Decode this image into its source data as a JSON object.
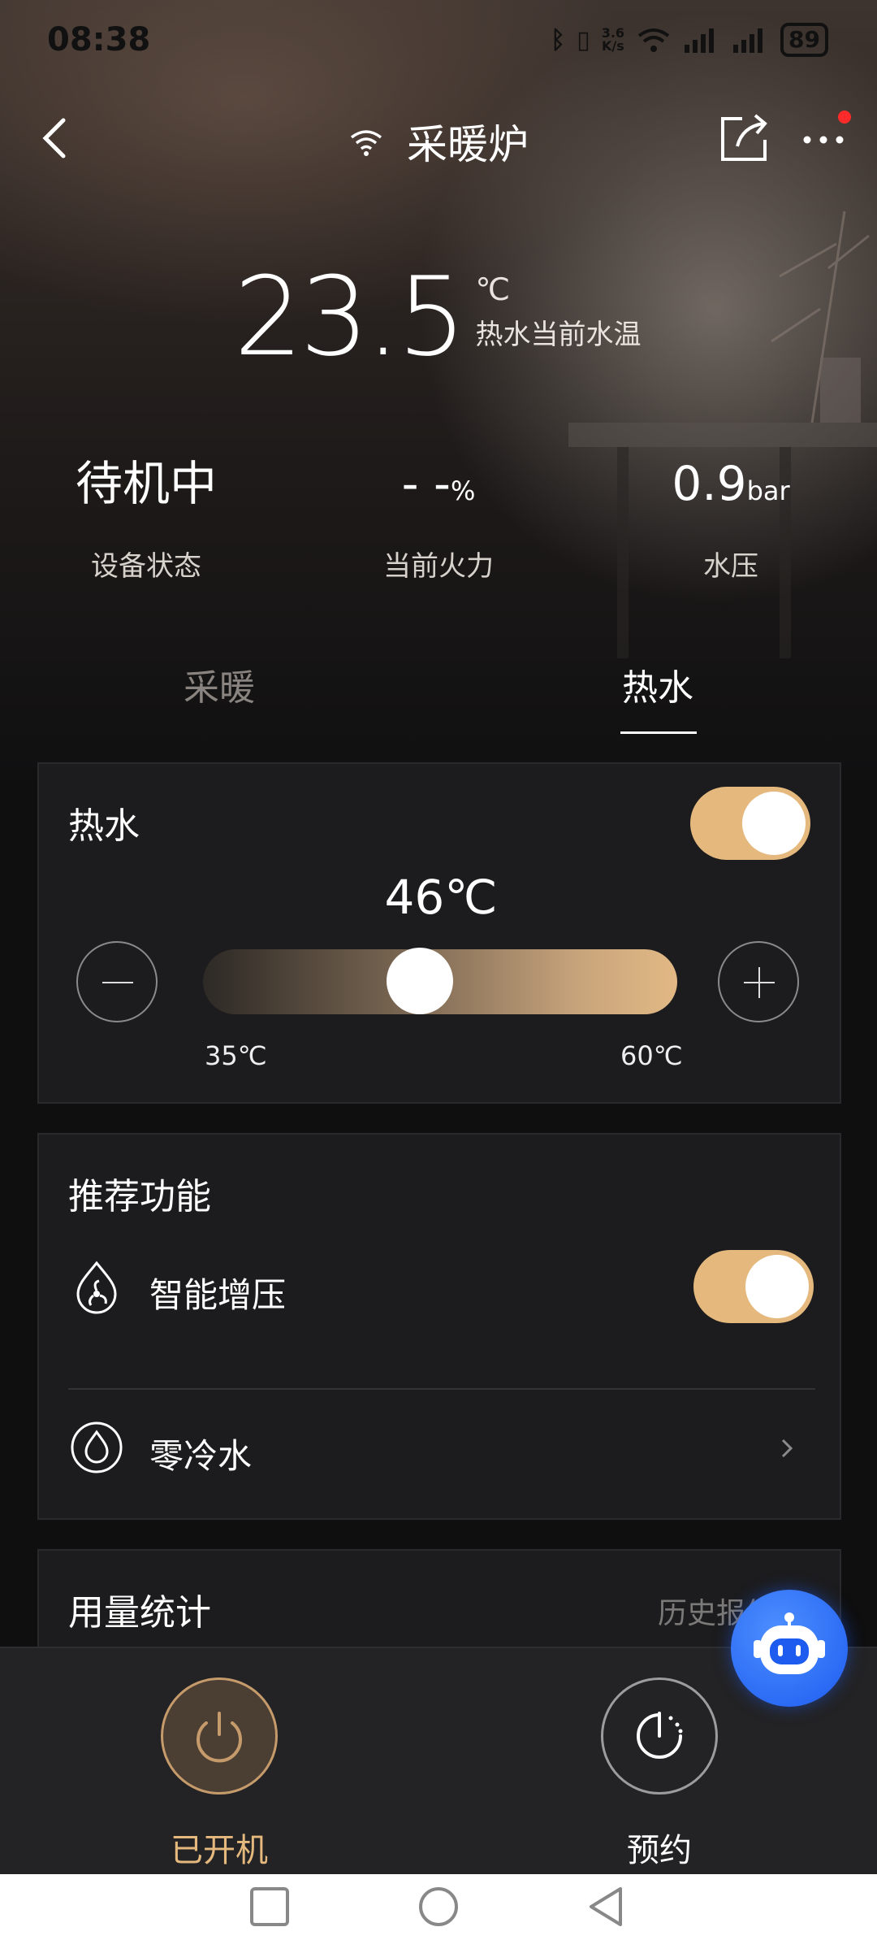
{
  "status_bar": {
    "time": "08:38",
    "network_speed": "3.6\nK/s",
    "battery": "89"
  },
  "nav": {
    "title": "采暖炉"
  },
  "hero": {
    "temperature": "23.5",
    "unit": "℃",
    "desc": "热水当前水温"
  },
  "stats": [
    {
      "value": "待机中",
      "unit": "",
      "label": "设备状态"
    },
    {
      "value": "- -",
      "unit": "%",
      "label": "当前火力"
    },
    {
      "value": "0.9",
      "unit": "bar",
      "label": "水压"
    }
  ],
  "tabs": [
    {
      "label": "采暖"
    },
    {
      "label": "热水"
    }
  ],
  "hot_water": {
    "title": "热水",
    "toggle_on": true,
    "set_temp": "46℃",
    "min": "35℃",
    "max": "60℃",
    "level_fraction": 0.44
  },
  "recommended": {
    "title": "推荐功能",
    "items": [
      {
        "label": "智能增压",
        "toggle_on": true
      },
      {
        "label": "零冷水"
      }
    ]
  },
  "usage": {
    "title": "用量统计",
    "link": "历史报告"
  },
  "bottom_actions": [
    {
      "label": "已开机"
    },
    {
      "label": "预约"
    }
  ],
  "colors": {
    "accent": "#E5B97E",
    "card": "#1C1C1E",
    "background": "#0F0F10",
    "ai_blue": "#1E5CF0"
  }
}
